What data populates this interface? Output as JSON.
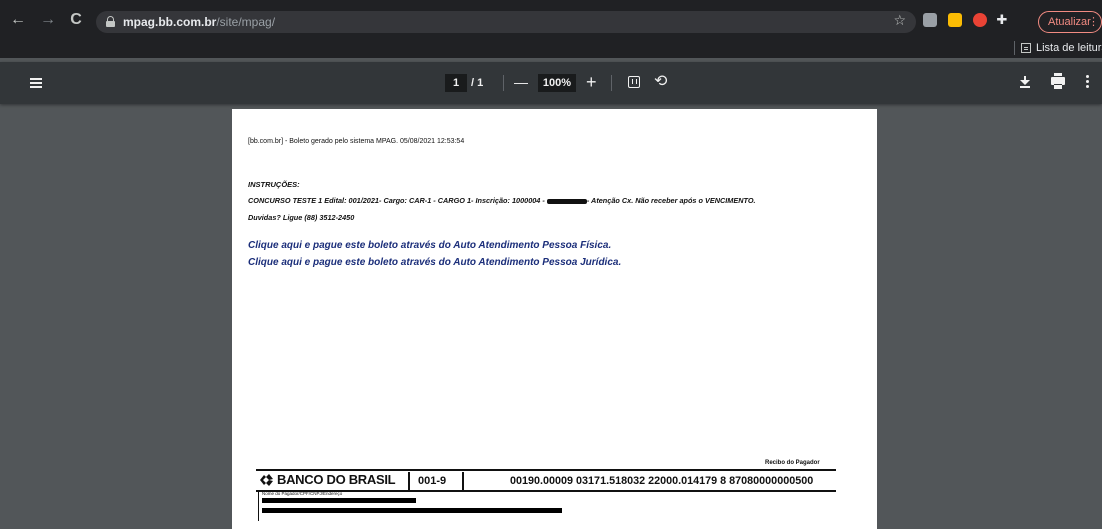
{
  "browser": {
    "url_host": "mpag.bb.com.br",
    "url_path": "/site/mpag/",
    "update_label": "Atualizar",
    "reading_list_label": "Lista de leitura",
    "extension_colors": [
      "#9aa0a6",
      "#fbbc04",
      "#ea4335"
    ]
  },
  "pdf_toolbar": {
    "current_page": "1",
    "total_pages": "/ 1",
    "zoom": "100%",
    "zoom_out_symbol": "—",
    "zoom_in_symbol": "+",
    "rotate_symbol": "⟲"
  },
  "document": {
    "header_line": "[bb.com.br] - Boleto gerado pelo sistema MPAG. 05/08/2021 12:53:54",
    "instructions_title": "INSTRUÇÕES:",
    "instructions_line1_a": "CONCURSO TESTE 1 Edital: 001/2021- Cargo: CAR-1 - CARGO 1- Inscrição: 1000004 -",
    "instructions_line1_b": "- Atenção Cx. Não receber após o VENCIMENTO.",
    "instructions_line2": "Duvidas? Ligue (88) 3512-2450",
    "link_pf": "Clique aqui e pague este boleto através do Auto Atendimento Pessoa Física.",
    "link_pj": "Clique aqui e pague este boleto através do Auto Atendimento Pessoa Jurídica.",
    "receipt_label": "Recibo do Pagador",
    "bank_name": "BANCO DO BRASIL",
    "bank_code": "001-9",
    "digitable_line": "00190.00009 03171.518032 22000.014179 8 87080000000500",
    "payer_label": "Nome do Pagador/CPF/CNPJ/Endereço"
  },
  "colors": {
    "link_blue": "#1b2e7a",
    "update_red": "#f28b82",
    "viewer_bg": "#525659"
  }
}
